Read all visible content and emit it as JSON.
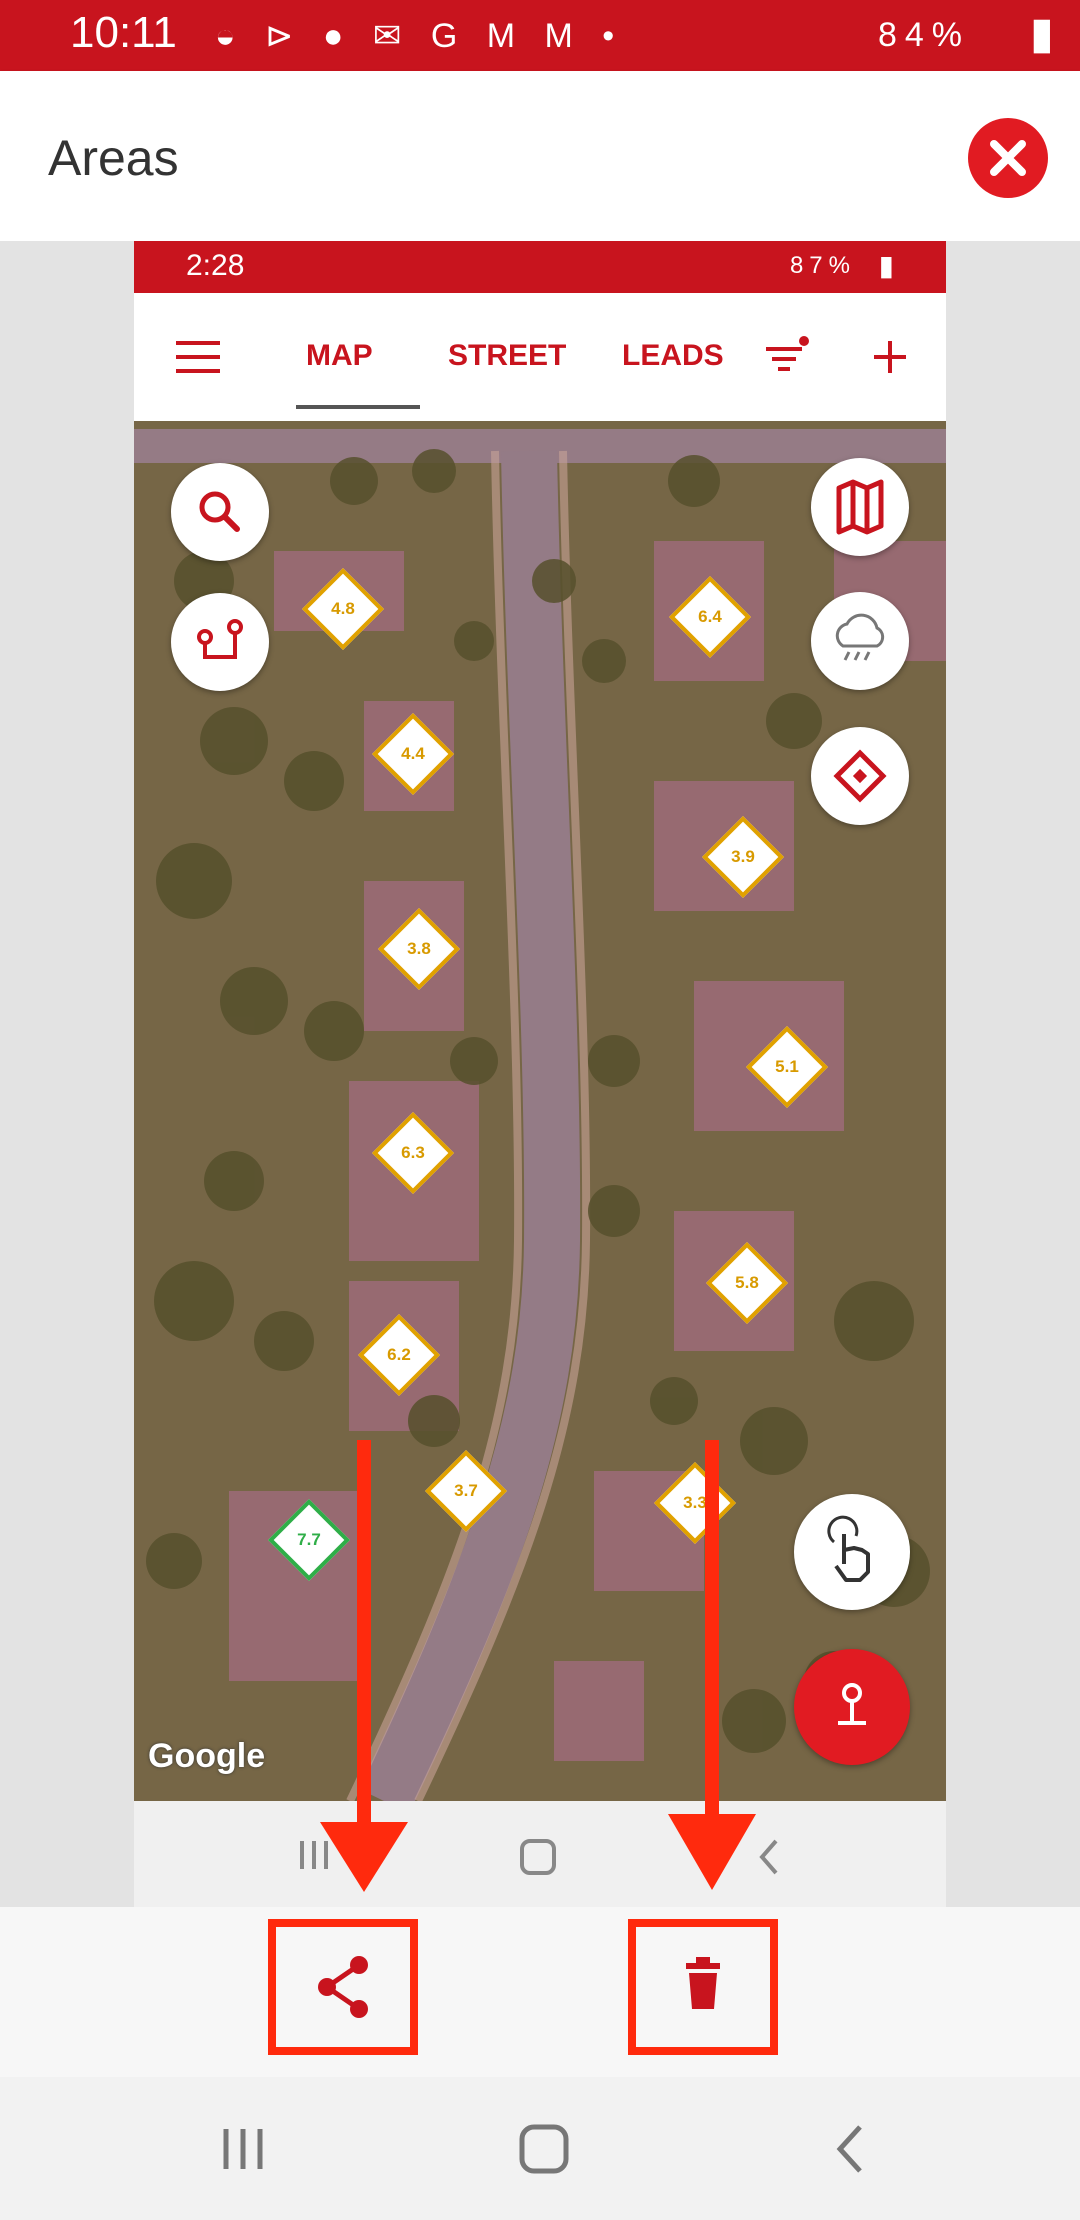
{
  "outer_status": {
    "time": "10:11",
    "battery": "84%"
  },
  "header": {
    "title": "Areas"
  },
  "inner": {
    "status": {
      "time": "2:28",
      "battery": "87%"
    },
    "tabs": [
      {
        "label": "MAP",
        "active": true
      },
      {
        "label": "STREET"
      },
      {
        "label": "LEADS"
      }
    ],
    "map_markers": [
      "4.8",
      "6.4",
      "4.4",
      "3.9",
      "3.8",
      "5.1",
      "6.3",
      "5.8",
      "6.2",
      "3.7",
      "3.3",
      "7.7"
    ],
    "google_label": "Google"
  },
  "colors": {
    "brand_red": "#c8141e",
    "marker_orange": "#e0a100",
    "marker_green": "#2fae48",
    "annotation_red": "#ff2a0d"
  },
  "icons": [
    "menu-icon",
    "filter-icon",
    "plus-icon",
    "search-icon",
    "route-icon",
    "map-layers-icon",
    "weather-icon",
    "diamond-icon",
    "hand-pointer-icon",
    "pin-icon",
    "share-icon",
    "trash-icon",
    "close-icon"
  ]
}
